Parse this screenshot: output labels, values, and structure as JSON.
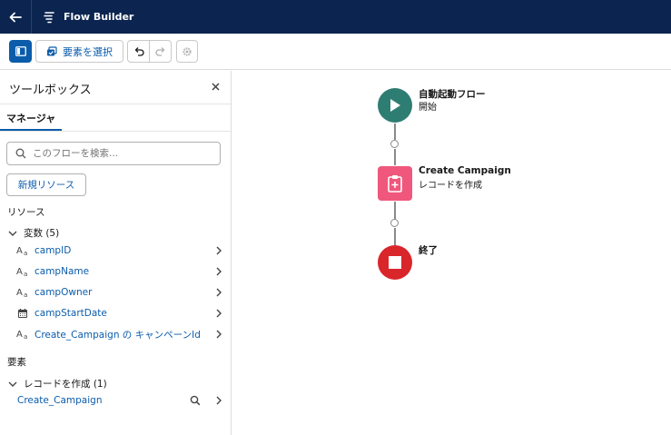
{
  "app": {
    "title": "Flow Builder"
  },
  "toolbar": {
    "select_elements_label": "要素を選択"
  },
  "toolbox": {
    "title": "ツールボックス",
    "tab_manager": "マネージャ",
    "search_placeholder": "このフローを検索...",
    "new_resource_label": "新規リソース",
    "resources_label": "リソース",
    "variables_group": "変数 (5)",
    "variables": [
      {
        "name": "campID",
        "icon": "text-icon"
      },
      {
        "name": "campName",
        "icon": "text-icon"
      },
      {
        "name": "campOwner",
        "icon": "text-icon"
      },
      {
        "name": "campStartDate",
        "icon": "calendar-icon"
      },
      {
        "name": "Create_Campaign の キャンペーンId",
        "icon": "text-icon"
      }
    ],
    "elements_label": "要素",
    "elements_group": "レコードを作成 (1)",
    "elements": [
      {
        "name": "Create_Campaign"
      }
    ]
  },
  "canvas": {
    "start_title": "自動起動フロー",
    "start_sub": "開始",
    "create_title": "Create Campaign",
    "create_sub": "レコードを作成",
    "end_title": "終了",
    "colors": {
      "start": "#2e7d73",
      "create": "#f0577c",
      "end": "#d9262b"
    }
  }
}
